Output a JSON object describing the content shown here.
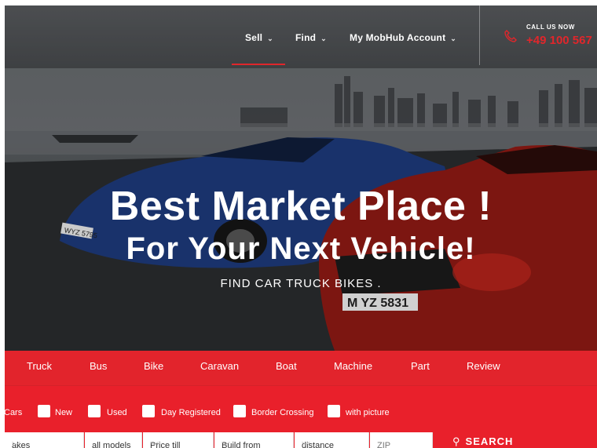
{
  "nav": {
    "items": [
      {
        "label": "Sell"
      },
      {
        "label": "Find"
      },
      {
        "label": "My MobHub Account"
      }
    ],
    "call_label": "CALL US NOW",
    "call_number": "+49 100 567"
  },
  "hero": {
    "headline": "Best Market Place !",
    "subheadline": "For Your Next Vehicle!",
    "tagline": "FIND CAR TRUCK BIKES .",
    "plate_left": "WYZ 5795",
    "plate_right": "M YZ 5831"
  },
  "categories": [
    "Truck",
    "Bus",
    "Bike",
    "Caravan",
    "Boat",
    "Machine",
    "Part",
    "Review"
  ],
  "filters": {
    "lead_label": "Cars",
    "checkboxes": [
      "New",
      "Used",
      "Day Registered",
      "Border Crossing",
      "with picture"
    ]
  },
  "search": {
    "fields": [
      {
        "value": "akes"
      },
      {
        "value": "all models"
      },
      {
        "value": "Price till"
      },
      {
        "value": "Build from"
      },
      {
        "value": "distance"
      },
      {
        "value": "ZIP"
      }
    ],
    "button_label": "SEARCH"
  },
  "colors": {
    "accent": "#e9202b",
    "nav_text": "#ffffff"
  }
}
